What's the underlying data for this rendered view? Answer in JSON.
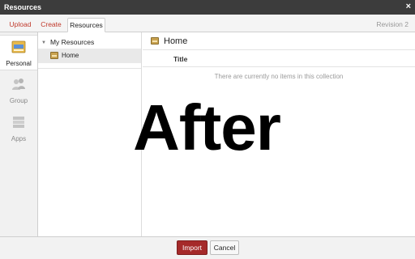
{
  "window": {
    "title": "Resources",
    "close_glyph": "×"
  },
  "tabs": [
    {
      "label": "Upload",
      "active": false
    },
    {
      "label": "Create",
      "active": false
    },
    {
      "label": "Resources",
      "active": true
    }
  ],
  "revision": "Revision 2",
  "leftnav": [
    {
      "label": "Personal",
      "icon": "personal-folder-icon",
      "active": true
    },
    {
      "label": "Group",
      "icon": "group-icon",
      "active": false
    },
    {
      "label": "Apps",
      "icon": "apps-icon",
      "active": false
    }
  ],
  "tree": {
    "root": "My Resources",
    "children": [
      {
        "label": "Home",
        "icon": "folder-icon",
        "selected": true
      }
    ]
  },
  "content": {
    "title": "Home",
    "column": "Title",
    "empty_message": "There are currently no items in this collection"
  },
  "overlay_text": "After",
  "footer": {
    "import_label": "Import",
    "cancel_label": "Cancel"
  },
  "colors": {
    "accent": "#a52a2a",
    "titlebar": "#3c3c3c",
    "tab_text": "#c0392b"
  }
}
